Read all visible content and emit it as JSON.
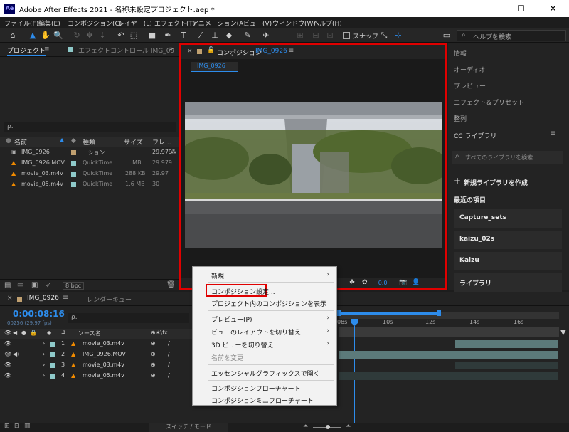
{
  "window": {
    "title": "Adobe After Effects 2021 - 名称未設定プロジェクト.aep *",
    "app_icon": "Ae"
  },
  "menu": [
    "ファイル(F)",
    "編集(E)",
    "コンポジション(C)",
    "レイヤー(L)",
    "エフェクト(T)",
    "アニメーション(A)",
    "ビュー(V)",
    "ウィンドウ(W)",
    "ヘルプ(H)"
  ],
  "toolbar": {
    "snap_label": "スナップ",
    "help_search_placeholder": "ヘルプを検索"
  },
  "project_panel": {
    "tab_label": "プロジェクト",
    "effect_tab_label": "エフェクトコントロール IMG_09",
    "search_placeholder": "ρ.",
    "columns": [
      "名前",
      "種類",
      "サイズ",
      "フレ..."
    ],
    "rows": [
      {
        "name": "IMG_0926",
        "type": "...ション",
        "size": "",
        "fps": "29.979",
        "color": "#c0a070"
      },
      {
        "name": "IMG_0926.MOV",
        "type": "QuickTime",
        "size": "... MB",
        "fps": "29.979",
        "color": "#8ec9c9"
      },
      {
        "name": "movie_03.m4v",
        "type": "QuickTime",
        "size": "288 KB",
        "fps": "29.97",
        "color": "#8ec9c9"
      },
      {
        "name": "movie_05.m4v",
        "type": "QuickTime",
        "size": "1.6 MB",
        "fps": "30",
        "color": "#8ec9c9"
      }
    ],
    "bpc_label": "8 bpc"
  },
  "comp_panel": {
    "tab_prefix": "コンポジション",
    "tab_name": "IMG_0926",
    "subtab": "IMG_0926",
    "exposure": "+0.0"
  },
  "right_panel": {
    "items": [
      "情報",
      "オーディオ",
      "プレビュー",
      "エフェクト＆プリセット",
      "整列",
      "CC ライブラリ"
    ],
    "search_placeholder": "すべてのライブラリを検索",
    "new_library": "新規ライブラリを作成",
    "recent_label": "最近の項目",
    "libraries": [
      "Capture_sets",
      "kaizu_02s",
      "Kaizu",
      "ライブラリ"
    ]
  },
  "timeline": {
    "tab_label": "IMG_0926",
    "render_queue_label": "レンダーキュー",
    "timecode": "0:00:08:16",
    "frame_info": "00256 (29.97 fps)",
    "search_placeholder": "ρ.",
    "source_name_header": "ソース名",
    "ruler": [
      "08s",
      "10s",
      "12s",
      "14s",
      "16s"
    ],
    "layers": [
      {
        "num": "1",
        "name": "movie_03.m4v"
      },
      {
        "num": "2",
        "name": "IMG_0926.MOV"
      },
      {
        "num": "3",
        "name": "movie_03.m4v"
      },
      {
        "num": "4",
        "name": "movie_05.m4v"
      }
    ],
    "switch_mode_label": "スイッチ / モード"
  },
  "context_menu": {
    "items": [
      {
        "label": "新規",
        "submenu": true,
        "disabled": false
      },
      {
        "label": "コンポジション設定...",
        "submenu": false,
        "disabled": false
      },
      {
        "label": "プロジェクト内のコンポジションを表示",
        "submenu": false,
        "disabled": false
      },
      {
        "label": "プレビュー(P)",
        "submenu": true,
        "disabled": false
      },
      {
        "label": "ビューのレイアウトを切り替え",
        "submenu": true,
        "disabled": false
      },
      {
        "label": "3D ビューを切り替え",
        "submenu": true,
        "disabled": false
      },
      {
        "label": "名前を変更",
        "submenu": false,
        "disabled": true
      },
      {
        "label": "エッセンシャルグラフィックスで開く",
        "submenu": false,
        "disabled": false
      },
      {
        "label": "コンポジションフローチャート",
        "submenu": false,
        "disabled": false
      },
      {
        "label": "コンポジションミニフローチャート",
        "submenu": false,
        "disabled": false
      }
    ]
  },
  "colors": {
    "accent": "#2d8ceb",
    "highlight": "#e00000"
  }
}
